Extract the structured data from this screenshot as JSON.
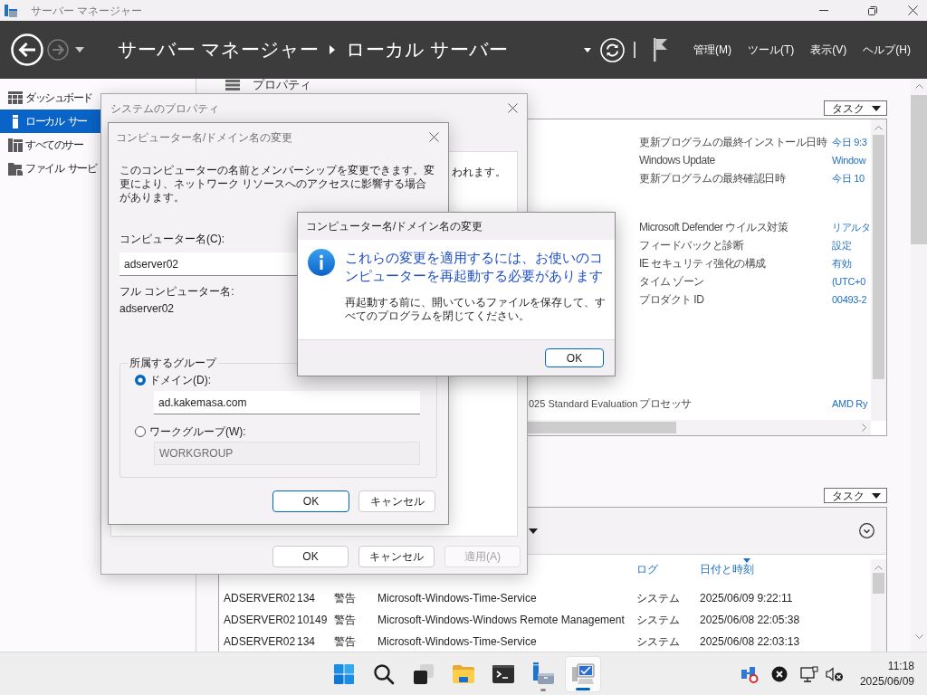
{
  "window": {
    "title": "サーバー マネージャー"
  },
  "header": {
    "breadcrumb": [
      "サーバー マネージャー",
      "ローカル サーバー"
    ],
    "menu": [
      "管理(M)",
      "ツール(T)",
      "表示(V)",
      "ヘルプ(H)"
    ]
  },
  "sidebar": {
    "items": [
      {
        "label": "ダッシュボード",
        "selected": false
      },
      {
        "label": "ローカル サー",
        "selected": true
      },
      {
        "label": "すべてのサー",
        "selected": false
      },
      {
        "label": "ファイル サービ",
        "selected": false
      }
    ]
  },
  "properties": {
    "title": "プロパティ",
    "task_button": "タスク",
    "groups": [
      [
        {
          "label": "更新プログラムの最終インストール日時",
          "value": "今日 9:3"
        },
        {
          "label": "Windows Update",
          "value": "Window"
        },
        {
          "label": "更新プログラムの最終確認日時",
          "value": "今日 10"
        }
      ],
      [
        {
          "label": "Microsoft Defender ウイルス対策",
          "value": "リアルタ"
        },
        {
          "label": "フィードバックと診断",
          "value": "設定"
        },
        {
          "label": "IE セキュリティ強化の構成",
          "value": "有効"
        },
        {
          "label": "タイム ゾーン",
          "value": "(UTC+0"
        },
        {
          "label": "プロダクト ID",
          "value": "00493-2"
        }
      ],
      [
        {
          "column_1": "025 Standard Evaluation",
          "label": "プロセッサ",
          "value": "AMD Ry"
        }
      ]
    ]
  },
  "events": {
    "task_button": "タスク",
    "columns": [
      {
        "label": "ログ",
        "sorted": false
      },
      {
        "label": "日付と時刻",
        "sorted": true
      }
    ],
    "rows": [
      {
        "server": "ADSERVER02",
        "id": "134",
        "level": "警告",
        "source": "Microsoft-Windows-Time-Service",
        "log": "システム",
        "date": "2025/06/09 9:22:11"
      },
      {
        "server": "ADSERVER02",
        "id": "10149",
        "level": "警告",
        "source": "Microsoft-Windows-Windows Remote Management",
        "log": "システム",
        "date": "2025/06/08 22:05:38"
      },
      {
        "server": "ADSERVER02",
        "id": "134",
        "level": "警告",
        "source": "Microsoft-Windows-Time-Service",
        "log": "システム",
        "date": "2025/06/08 22:03:13"
      }
    ]
  },
  "system_properties": {
    "title": "システムのプロパティ",
    "text": "われます。",
    "buttons": [
      {
        "label": "OK",
        "disabled": false
      },
      {
        "label": "キャンセル",
        "disabled": false
      },
      {
        "label": "適用(A)",
        "disabled": true
      }
    ]
  },
  "name_change_dialog": {
    "title": "コンピューター名/ドメイン名の変更",
    "description": "このコンピューターの名前とメンバーシップを変更できます。変更により、ネットワーク リソースへのアクセスに影響する場合があります。",
    "computer_name_label": "コンピューター名(C):",
    "computer_name": "adserver02",
    "full_name_label": "フル コンピューター名:",
    "full_name": "adserver02",
    "member_of": {
      "legend": "所属するグループ",
      "options": [
        {
          "label": "ドメイン(D):",
          "selected": true,
          "value": "ad.kakemasa.com"
        },
        {
          "label": "ワークグループ(W):",
          "selected": false,
          "value": "WORKGROUP"
        }
      ]
    },
    "buttons": [
      {
        "label": "OK",
        "default": true
      },
      {
        "label": "キャンセル",
        "default": false
      }
    ]
  },
  "message_box": {
    "title": "コンピューター名/ドメイン名の変更",
    "heading": "これらの変更を適用するには、お使いのコンピューターを再起動する必要があります",
    "body": "再起動する前に、開いているファイルを保存して、すべてのプログラムを閉じてください。",
    "button": "OK"
  },
  "taskbar": {
    "apps": [
      {
        "kind": "start",
        "running": false,
        "active": false
      },
      {
        "kind": "search",
        "running": false,
        "active": false
      },
      {
        "kind": "task_view",
        "running": false,
        "active": false
      },
      {
        "kind": "explorer",
        "running": false,
        "active": false
      },
      {
        "kind": "terminal",
        "running": false,
        "active": false
      },
      {
        "kind": "server_manager",
        "running": true,
        "active": false
      },
      {
        "kind": "system",
        "running": true,
        "active": true
      }
    ],
    "clock": {
      "time": "11:18",
      "date": "2025/06/09"
    }
  }
}
